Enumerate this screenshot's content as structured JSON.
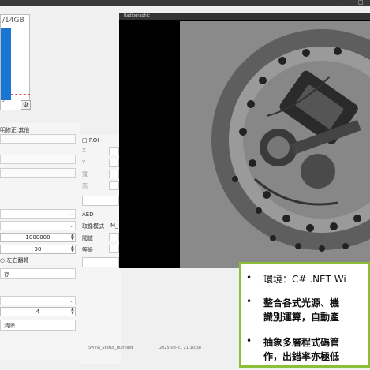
{
  "window": {
    "controls": [
      "-",
      "□"
    ]
  },
  "chart_panel": {
    "title": "/14GB",
    "label": "o"
  },
  "tabs_label": "明修正  其他",
  "settings": {
    "values": [
      "1000000",
      "30"
    ],
    "radio_text": "○ 左右翻轉",
    "save_label": "存",
    "count": "4",
    "clear_label": "清除"
  },
  "roi": {
    "header": "ROI",
    "labels": [
      "X",
      "Y",
      "寬",
      "高"
    ]
  },
  "aed": {
    "header": "AED",
    "mode_label": "取像模式",
    "mode_value": "M_",
    "threshold_label": "閥值",
    "level_label": "等級"
  },
  "viewer": {
    "title": "Radiographic"
  },
  "status": {
    "left": "Sylvia_Status_Running",
    "right": "2025-08-21 21:10:38"
  },
  "callout": {
    "line1": "環境：C# .NET Wi",
    "line2a": "整合各式光源、機",
    "line2b": "識別運算，自動產",
    "line3a": "抽象多層程式碼管",
    "line3b": "作，出錯率亦極低"
  },
  "colors": {
    "accent_green": "#8bbf3a",
    "bar_blue": "#1976d2"
  }
}
